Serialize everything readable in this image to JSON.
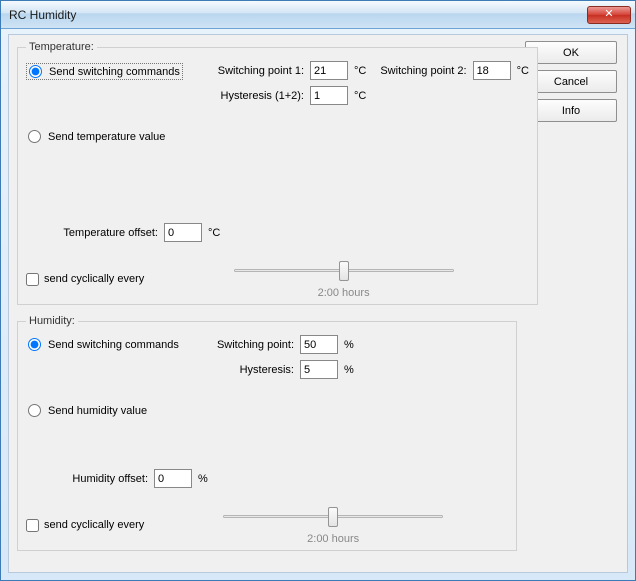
{
  "window": {
    "title": "RC Humidity"
  },
  "buttons": {
    "ok": "OK",
    "cancel": "Cancel",
    "info": "Info"
  },
  "temp": {
    "legend": "Temperature:",
    "radio_switch": "Send switching commands",
    "radio_value": "Send temperature value",
    "sp1_label": "Switching point 1:",
    "sp1_value": "21",
    "sp2_label": "Switching point 2:",
    "sp2_value": "18",
    "deg": "°C",
    "hyst_label": "Hysteresis (1+2):",
    "hyst_value": "1",
    "offset_label": "Temperature offset:",
    "offset_value": "0",
    "cyc_label": "send cyclically every",
    "slider_caption": "2:00 hours"
  },
  "hum": {
    "legend": "Humidity:",
    "radio_switch": "Send switching commands",
    "radio_value": "Send humidity value",
    "sp_label": "Switching point:",
    "sp_value": "50",
    "pct": "%",
    "hyst_label": "Hysteresis:",
    "hyst_value": "5",
    "offset_label": "Humidity offset:",
    "offset_value": "0",
    "cyc_label": "send cyclically every",
    "slider_caption": "2:00 hours"
  }
}
